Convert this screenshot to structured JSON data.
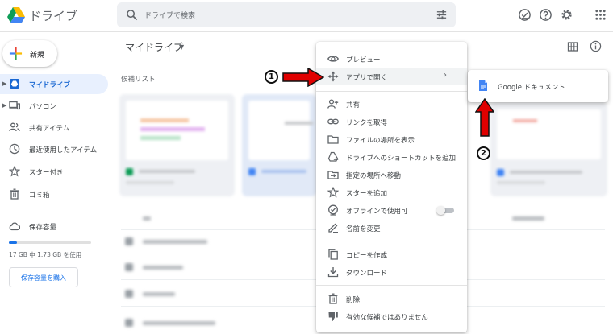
{
  "app": {
    "title": "ドライブ",
    "search_placeholder": "ドライブで検索"
  },
  "sidebar": {
    "new_label": "新規",
    "items": [
      {
        "label": "マイドライブ",
        "icon": "my-drive-icon",
        "active": true
      },
      {
        "label": "パソコン",
        "icon": "computer-icon",
        "active": false
      },
      {
        "label": "共有アイテム",
        "icon": "shared-icon",
        "active": false
      },
      {
        "label": "最近使用したアイテム",
        "icon": "recent-icon",
        "active": false
      },
      {
        "label": "スター付き",
        "icon": "star-icon",
        "active": false
      },
      {
        "label": "ゴミ箱",
        "icon": "trash-icon",
        "active": false
      },
      {
        "label": "保存容量",
        "icon": "cloud-icon",
        "active": false
      }
    ],
    "storage_text": "17 GB 中 1.73 GB を使用",
    "storage_fraction": 0.1,
    "buy_label": "保存容量を購入"
  },
  "main": {
    "breadcrumb": "マイドライブ",
    "section_label": "候補リスト"
  },
  "context_menu": {
    "items": [
      {
        "label": "プレビュー",
        "icon": "eye-icon"
      },
      {
        "label": "アプリで開く",
        "icon": "open-with-icon",
        "submenu": true
      },
      {
        "label": "共有",
        "icon": "person-add-icon"
      },
      {
        "label": "リンクを取得",
        "icon": "link-icon"
      },
      {
        "label": "ファイルの場所を表示",
        "icon": "folder-icon"
      },
      {
        "label": "ドライブへのショートカットを追加",
        "icon": "add-shortcut-icon"
      },
      {
        "label": "指定の場所へ移動",
        "icon": "move-icon"
      },
      {
        "label": "スターを追加",
        "icon": "star-outline-icon"
      },
      {
        "label": "オフラインで使用可",
        "icon": "offline-icon",
        "toggle": false
      },
      {
        "label": "名前を変更",
        "icon": "rename-icon"
      },
      {
        "label": "コピーを作成",
        "icon": "copy-icon"
      },
      {
        "label": "ダウンロード",
        "icon": "download-icon"
      },
      {
        "label": "削除",
        "icon": "delete-icon"
      },
      {
        "label": "有効な候補ではありません",
        "icon": "thumb-down-icon"
      }
    ],
    "submenu": {
      "label": "Google ドキュメント",
      "icon": "google-docs-icon"
    }
  },
  "annotations": [
    {
      "number": "1",
      "label": "①"
    },
    {
      "number": "2",
      "label": "②"
    }
  ],
  "colors": {
    "accent": "#1a73e8",
    "active_bg": "#e8f0fe",
    "arrow_red": "#e00000",
    "docs_blue": "#4285f4"
  }
}
